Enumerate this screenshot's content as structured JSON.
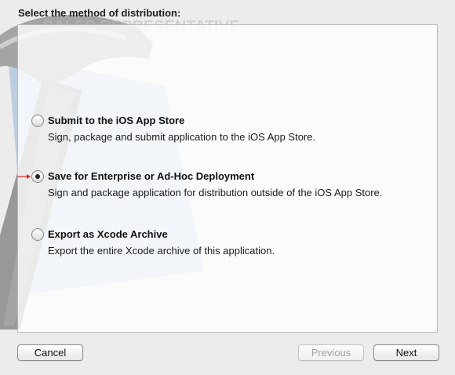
{
  "dialog": {
    "heading": "Select the method of distribution:"
  },
  "options": [
    {
      "title": "Submit to the iOS App Store",
      "description": "Sign, package and submit application to the iOS App Store.",
      "selected": false
    },
    {
      "title": "Save for Enterprise or Ad-Hoc Deployment",
      "description": "Sign and package application for distribution outside of the iOS App Store.",
      "selected": true
    },
    {
      "title": "Export as Xcode Archive",
      "description": "Export the entire Xcode archive of this application.",
      "selected": false
    }
  ],
  "buttons": {
    "cancel": "Cancel",
    "previous": "Previous",
    "previous_enabled": false,
    "next": "Next"
  },
  "background": {
    "watermark_text": "SALES REPRESENTATIVE",
    "icon": "xcode-hammer-blueprint-icon"
  },
  "colors": {
    "pointer_arrow": "#d12a1f",
    "blueprint_blue": "#4f8ac9"
  }
}
